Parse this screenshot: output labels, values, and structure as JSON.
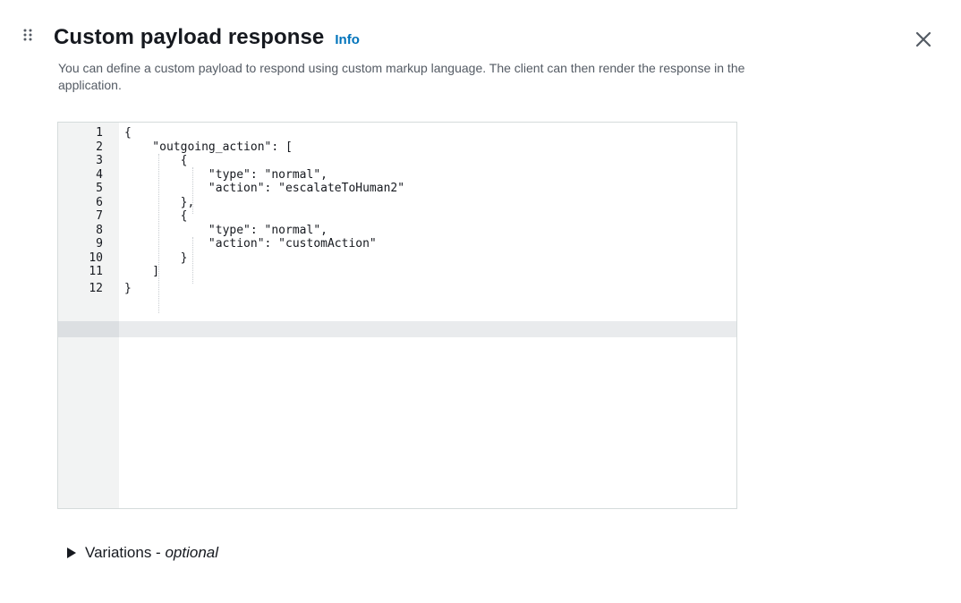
{
  "header": {
    "title": "Custom payload response",
    "info_label": "Info",
    "description": "You can define a custom payload to respond using custom markup language. The client can then render the response in the application."
  },
  "editor": {
    "active_line": 12,
    "lines": [
      {
        "number": "1",
        "text": "{"
      },
      {
        "number": "2",
        "text": "    \"outgoing_action\": ["
      },
      {
        "number": "3",
        "text": "        {"
      },
      {
        "number": "4",
        "text": "            \"type\": \"normal\","
      },
      {
        "number": "5",
        "text": "            \"action\": \"escalateToHuman2\""
      },
      {
        "number": "6",
        "text": "        },"
      },
      {
        "number": "7",
        "text": "        {"
      },
      {
        "number": "8",
        "text": "            \"type\": \"normal\","
      },
      {
        "number": "9",
        "text": "            \"action\": \"customAction\""
      },
      {
        "number": "10",
        "text": "        }"
      },
      {
        "number": "11",
        "text": "    ]"
      },
      {
        "number": "12",
        "text": "}"
      }
    ]
  },
  "variations": {
    "label": "Variations - ",
    "optional_label": "optional"
  },
  "colors": {
    "accent": "#0073bb",
    "text": "#16191f",
    "muted_text": "#545b64",
    "gutter": "#f2f3f3",
    "border": "#d5dbdb"
  },
  "icons": {
    "drag": "drag-handle-icon",
    "close": "close-icon",
    "expand": "caret-right-icon"
  }
}
